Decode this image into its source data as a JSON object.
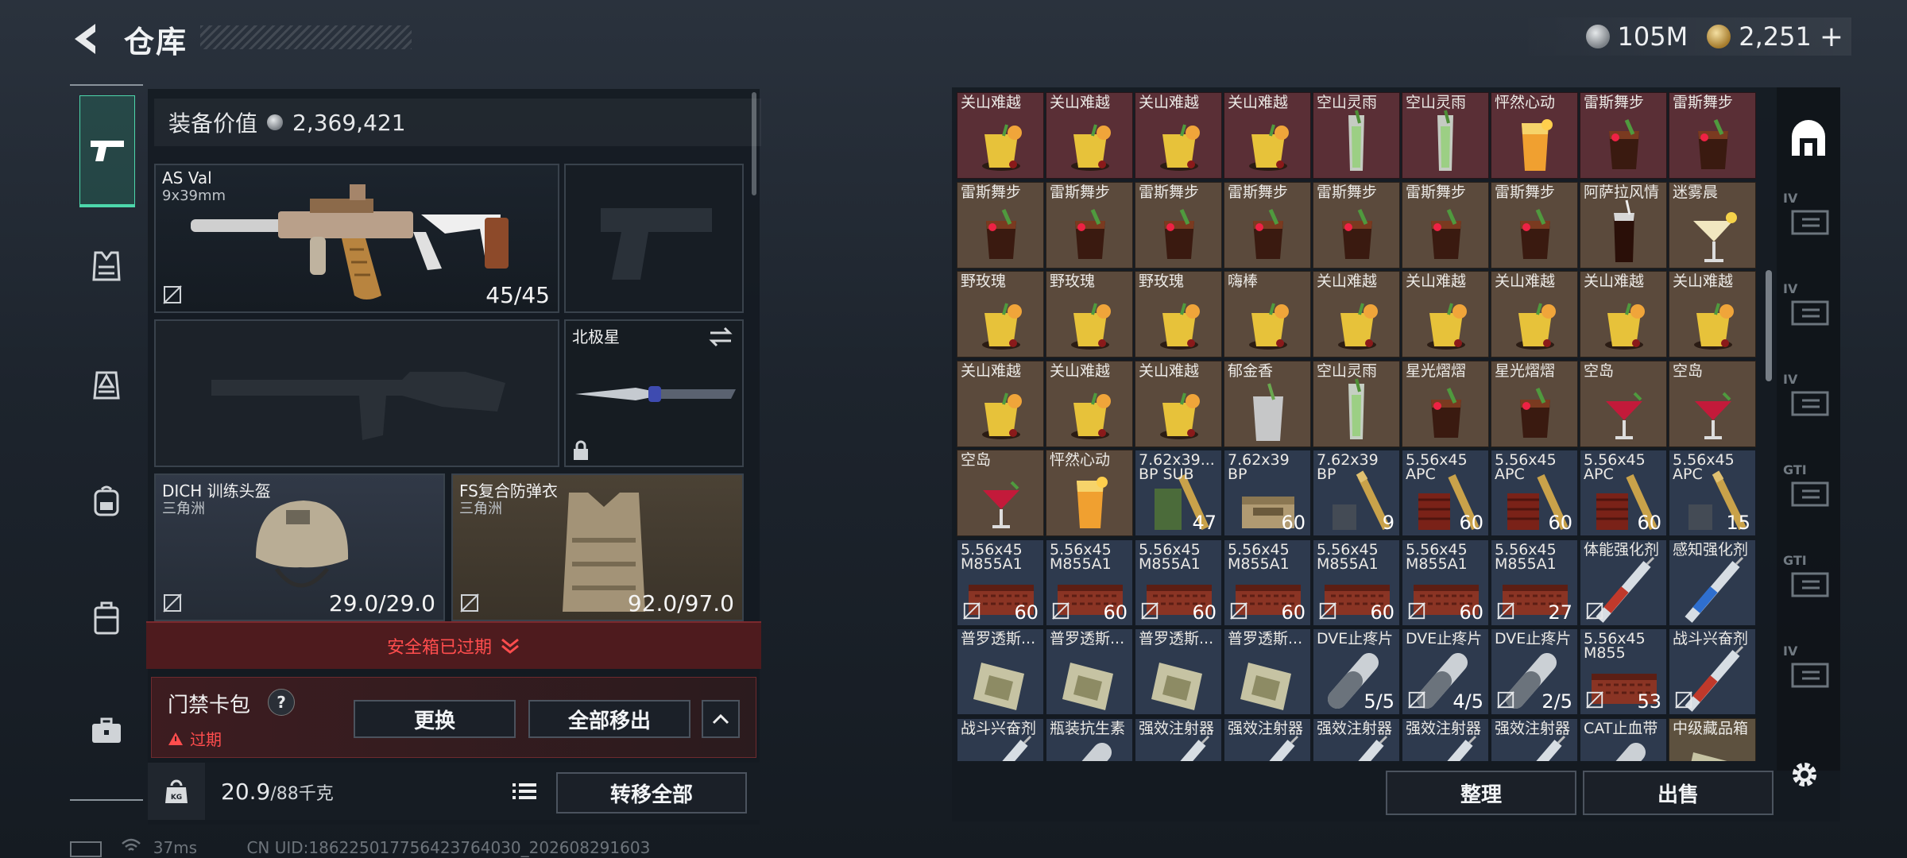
{
  "header": {
    "title": "仓库"
  },
  "currency": {
    "silver": "105M",
    "gold": "2,251",
    "plus": "+"
  },
  "equip": {
    "label": "装备价值",
    "value": "2,369,421",
    "primary": {
      "name": "AS Val",
      "sub": "9x39mm",
      "ammo": "45/45"
    },
    "melee": {
      "name": "北极星"
    },
    "helmet": {
      "name": "DICH 训练头盔",
      "sub": "三角洲",
      "durability": "29.0/29.0"
    },
    "armor": {
      "name": "FS复合防弹衣",
      "sub": "三角洲",
      "durability": "92.0/97.0"
    },
    "safe_box": "安全箱已过期",
    "card_pack": {
      "label": "门禁卡包",
      "help": "?",
      "status": "过期",
      "replace": "更换",
      "remove_all": "全部移出",
      "expand": "^"
    },
    "weight": {
      "value": "20.9",
      "max": "/88千克",
      "kg": "KG"
    },
    "transfer_all": "转移全部"
  },
  "inventory": {
    "cells": [
      {
        "n": "关山难越",
        "q": "",
        "bg": "red",
        "ic": "yellow"
      },
      {
        "n": "关山难越",
        "q": "",
        "bg": "red",
        "ic": "yellow"
      },
      {
        "n": "关山难越",
        "q": "",
        "bg": "red",
        "ic": "yellow"
      },
      {
        "n": "关山难越",
        "q": "",
        "bg": "red",
        "ic": "yellow"
      },
      {
        "n": "空山灵雨",
        "q": "",
        "bg": "red",
        "ic": "tall"
      },
      {
        "n": "空山灵雨",
        "q": "",
        "bg": "red",
        "ic": "tall"
      },
      {
        "n": "怦然心动",
        "q": "",
        "bg": "red",
        "ic": "orange"
      },
      {
        "n": "雷斯舞步",
        "q": "",
        "bg": "red",
        "ic": "dark"
      },
      {
        "n": "雷斯舞步",
        "q": "",
        "bg": "red",
        "ic": "dark"
      },
      {
        "n": "雷斯舞步",
        "q": "",
        "bg": "brown",
        "ic": "dark"
      },
      {
        "n": "雷斯舞步",
        "q": "",
        "bg": "brown",
        "ic": "dark"
      },
      {
        "n": "雷斯舞步",
        "q": "",
        "bg": "brown",
        "ic": "dark"
      },
      {
        "n": "雷斯舞步",
        "q": "",
        "bg": "brown",
        "ic": "dark"
      },
      {
        "n": "雷斯舞步",
        "q": "",
        "bg": "brown",
        "ic": "dark"
      },
      {
        "n": "雷斯舞步",
        "q": "",
        "bg": "brown",
        "ic": "dark"
      },
      {
        "n": "雷斯舞步",
        "q": "",
        "bg": "brown",
        "ic": "dark"
      },
      {
        "n": "阿萨拉风情",
        "q": "",
        "bg": "brown",
        "ic": "cola"
      },
      {
        "n": "迷雾晨",
        "q": "",
        "bg": "brown",
        "ic": "martini"
      },
      {
        "n": "野玫瑰",
        "q": "",
        "bg": "brown",
        "ic": "yellow"
      },
      {
        "n": "野玫瑰",
        "q": "",
        "bg": "brown",
        "ic": "yellow"
      },
      {
        "n": "野玫瑰",
        "q": "",
        "bg": "brown",
        "ic": "yellow"
      },
      {
        "n": "嗨棒",
        "q": "",
        "bg": "brown",
        "ic": "yellow"
      },
      {
        "n": "关山难越",
        "q": "",
        "bg": "brown",
        "ic": "yellow"
      },
      {
        "n": "关山难越",
        "q": "",
        "bg": "brown",
        "ic": "yellow"
      },
      {
        "n": "关山难越",
        "q": "",
        "bg": "brown",
        "ic": "yellow"
      },
      {
        "n": "关山难越",
        "q": "",
        "bg": "brown",
        "ic": "yellow"
      },
      {
        "n": "关山难越",
        "q": "",
        "bg": "brown",
        "ic": "yellow"
      },
      {
        "n": "关山难越",
        "q": "",
        "bg": "brown",
        "ic": "yellow"
      },
      {
        "n": "关山难越",
        "q": "",
        "bg": "brown",
        "ic": "yellow"
      },
      {
        "n": "关山难越",
        "q": "",
        "bg": "brown",
        "ic": "yellow"
      },
      {
        "n": "郁金香",
        "q": "",
        "bg": "brown",
        "ic": "clear"
      },
      {
        "n": "空山灵雨",
        "q": "",
        "bg": "brown",
        "ic": "tall"
      },
      {
        "n": "星光熠熠",
        "q": "",
        "bg": "brown",
        "ic": "dark"
      },
      {
        "n": "星光熠熠",
        "q": "",
        "bg": "brown",
        "ic": "dark"
      },
      {
        "n": "空岛",
        "q": "",
        "bg": "brown",
        "ic": "redmartini"
      },
      {
        "n": "空岛",
        "q": "",
        "bg": "brown",
        "ic": "redmartini"
      },
      {
        "n": "空岛",
        "q": "",
        "bg": "brown",
        "ic": "redmartini"
      },
      {
        "n": "怦然心动",
        "q": "",
        "bg": "brown",
        "ic": "orange"
      },
      {
        "n": "7.62x39...",
        "q": "47",
        "bg": "blue",
        "ic": "ammogreen"
      },
      {
        "n": "7.62x39",
        "q": "60",
        "bg": "blue",
        "ic": "ammobox"
      },
      {
        "n": "7.62x39",
        "q": "9",
        "bg": "blue",
        "ic": "ammobullet"
      },
      {
        "n": "5.56x45",
        "q": "60",
        "bg": "blue",
        "ic": "ammored"
      },
      {
        "n": "5.56x45",
        "q": "60",
        "bg": "blue",
        "ic": "ammored"
      },
      {
        "n": "5.56x45",
        "q": "60",
        "bg": "blue",
        "ic": "ammored"
      },
      {
        "n": "5.56x45",
        "q": "15",
        "bg": "blue",
        "ic": "ammobullet"
      },
      {
        "n": "5.56x45",
        "q": "60",
        "bg": "blue",
        "ic": "ammoredbox"
      },
      {
        "n": "5.56x45",
        "q": "60",
        "bg": "blue",
        "ic": "ammoredbox"
      },
      {
        "n": "5.56x45",
        "q": "60",
        "bg": "blue",
        "ic": "ammoredbox"
      },
      {
        "n": "5.56x45",
        "q": "60",
        "bg": "blue",
        "ic": "ammoredbox"
      },
      {
        "n": "5.56x45",
        "q": "60",
        "bg": "blue",
        "ic": "ammoredbox"
      },
      {
        "n": "5.56x45",
        "q": "60",
        "bg": "blue",
        "ic": "ammoredbox"
      },
      {
        "n": "5.56x45",
        "q": "27",
        "bg": "blue",
        "ic": "ammoredbox"
      },
      {
        "n": "体能强化剂",
        "q": "",
        "bg": "blue",
        "ic": "syringe"
      },
      {
        "n": "感知强化剂",
        "q": "",
        "bg": "blue",
        "ic": "syringeblue"
      },
      {
        "n": "普罗透斯...",
        "q": "",
        "bg": "blue",
        "ic": "pack"
      },
      {
        "n": "普罗透斯...",
        "q": "",
        "bg": "blue",
        "ic": "pack"
      },
      {
        "n": "普罗透斯...",
        "q": "",
        "bg": "blue",
        "ic": "pack"
      },
      {
        "n": "普罗透斯...",
        "q": "",
        "bg": "blue",
        "ic": "pack"
      },
      {
        "n": "DVE止疼片",
        "q": "5/5",
        "bg": "blue",
        "ic": "pill"
      },
      {
        "n": "DVE止疼片",
        "q": "4/5",
        "bg": "blue",
        "ic": "pill"
      },
      {
        "n": "DVE止疼片",
        "q": "2/5",
        "bg": "blue",
        "ic": "pill"
      },
      {
        "n": "5.56x45",
        "q": "53",
        "bg": "blue",
        "ic": "ammoredbox"
      },
      {
        "n": "战斗兴奋剂",
        "q": "",
        "bg": "blue",
        "ic": "syringe"
      },
      {
        "n": "战斗兴奋剂",
        "q": "",
        "bg": "blue",
        "ic": "syringe"
      },
      {
        "n": "瓶装抗生素",
        "q": "",
        "bg": "blue",
        "ic": "pill"
      },
      {
        "n": "强效注射器",
        "q": "",
        "bg": "blue",
        "ic": "syringe"
      },
      {
        "n": "强效注射器",
        "q": "",
        "bg": "blue",
        "ic": "syringe"
      },
      {
        "n": "强效注射器",
        "q": "",
        "bg": "blue",
        "ic": "syringe"
      },
      {
        "n": "强效注射器",
        "q": "",
        "bg": "blue",
        "ic": "syringe"
      },
      {
        "n": "强效注射器",
        "q": "",
        "bg": "blue",
        "ic": "syringe"
      },
      {
        "n": "CAT止血带",
        "q": "",
        "bg": "blue",
        "ic": "pill"
      },
      {
        "n": "中级藏品箱",
        "q": "",
        "bg": "gold",
        "ic": "pack"
      }
    ],
    "subnames": {
      "38": "BP SUB",
      "39": "BP",
      "40": "BP",
      "41": "APC",
      "42": "APC",
      "43": "APC",
      "44": "APC",
      "45": "M855A1",
      "46": "M855A1",
      "47": "M855A1",
      "48": "M855A1",
      "49": "M855A1",
      "50": "M855A1",
      "51": "M855A1",
      "61": "M855"
    },
    "no_insure": [
      "45",
      "46",
      "47",
      "48",
      "49",
      "50",
      "51",
      "52",
      "59",
      "60",
      "61",
      "62",
      "63"
    ]
  },
  "right_tabs": [
    "IV",
    "IV",
    "IV",
    "GTI",
    "GTI",
    "IV"
  ],
  "actions": {
    "sort": "整理",
    "sell": "出售"
  },
  "status": {
    "ping": "37ms",
    "uid": "CN UID:1862250177564237640​30_202608291603"
  }
}
